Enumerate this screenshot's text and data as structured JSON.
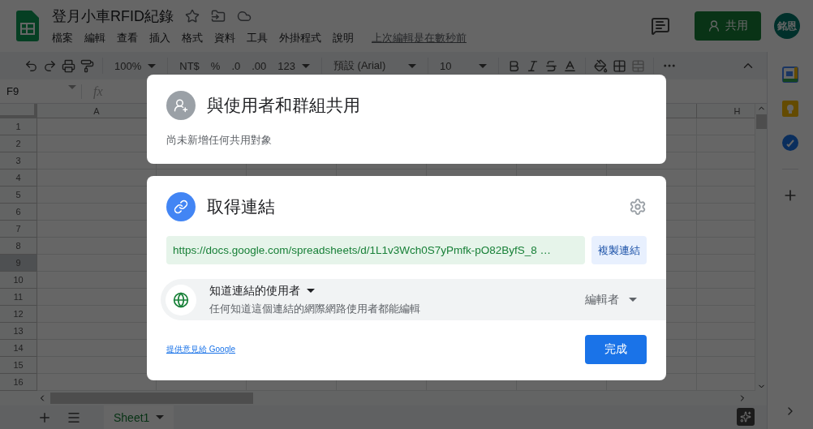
{
  "app": {
    "title": "登月小車RFID紀錄",
    "menu": [
      "檔案",
      "編輯",
      "查看",
      "插入",
      "格式",
      "資料",
      "工具",
      "外掛程式",
      "說明"
    ],
    "last_edit": "上次編輯是在數秒前",
    "share_button": "共用",
    "avatar": "銘恩"
  },
  "toolbar": {
    "zoom": "100%",
    "currency": "NT$",
    "percent": "%",
    "decimal_decrease": ".0",
    "decimal_increase": ".00",
    "number_format": "123",
    "font": "預設 (Arial)",
    "font_size": "10"
  },
  "formula_bar": {
    "cell_ref": "F9",
    "fx": "fx"
  },
  "grid": {
    "columns": [
      "A",
      "H"
    ],
    "rows": [
      {
        "label": "1",
        "selected": false
      },
      {
        "label": "2",
        "selected": false
      },
      {
        "label": "3",
        "selected": false
      },
      {
        "label": "4",
        "selected": false
      },
      {
        "label": "5",
        "selected": false
      },
      {
        "label": "6",
        "selected": false
      },
      {
        "label": "7",
        "selected": false
      },
      {
        "label": "8",
        "selected": false
      },
      {
        "label": "9",
        "selected": true
      },
      {
        "label": "10",
        "selected": false
      },
      {
        "label": "11",
        "selected": false
      },
      {
        "label": "12",
        "selected": false
      },
      {
        "label": "13",
        "selected": false
      },
      {
        "label": "14",
        "selected": false
      },
      {
        "label": "15",
        "selected": false
      },
      {
        "label": "16",
        "selected": false
      }
    ]
  },
  "sheet_tabs": [
    {
      "label": "Sheet1",
      "selected": true
    }
  ],
  "share_dialog": {
    "people": {
      "title": "與使用者和群組共用",
      "subtitle": "尚未新增任何共用對象"
    },
    "link": {
      "title": "取得連結",
      "url": "https://docs.google.com/spreadsheets/d/1L1v3Wch0S7yPmfk-pO82ByfS_8 …",
      "copy_button": "複製連結",
      "access": "知道連結的使用者",
      "access_description": "任何知道這個連結的網際網路使用者都能編輯",
      "role": "編輯者"
    },
    "feedback_link": "提供意見給 Google",
    "done_button": "完成"
  }
}
